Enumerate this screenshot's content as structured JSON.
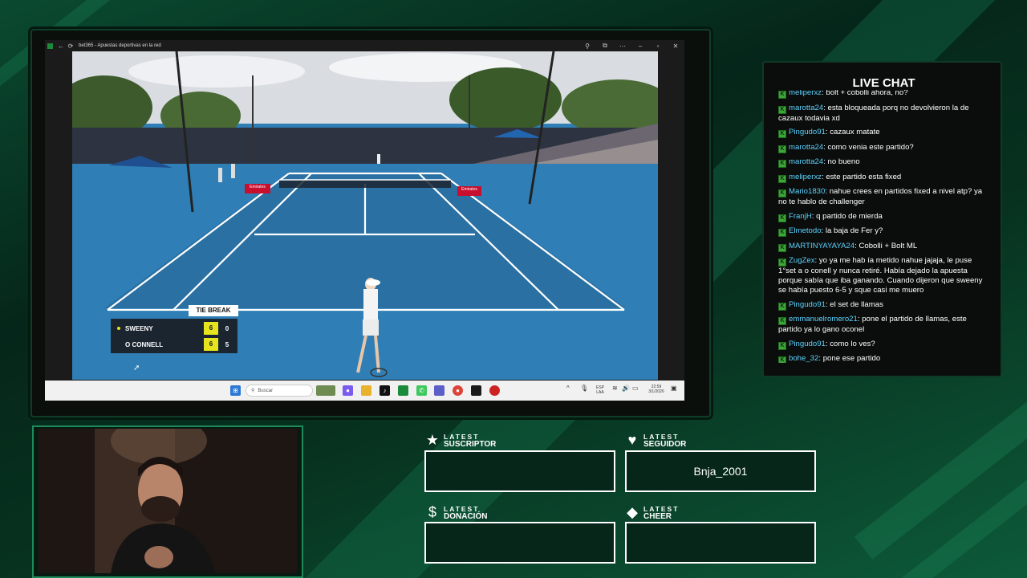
{
  "browser": {
    "title": "bet365 - Apuestas deportivas en la red"
  },
  "scoreboard": {
    "banner": "TIE BREAK",
    "players": [
      {
        "name": "SWEENY",
        "set": "6",
        "points": "0",
        "serving": true
      },
      {
        "name": "O CONNELL",
        "set": "6",
        "points": "5",
        "serving": false
      }
    ]
  },
  "court_signs": {
    "left": "Emirates",
    "right": "Emirates"
  },
  "taskbar": {
    "search_placeholder": "Buscar",
    "language": "ESP",
    "language_sub": "LAA",
    "time": "22:59",
    "date": "3/1/2026"
  },
  "chat": {
    "title": "LIVE CHAT",
    "messages": [
      {
        "user": "meliperxz",
        "text": "bolt + cobolli ahora, no?"
      },
      {
        "user": "marotta24",
        "text": "esta bloqueada porq no devolvieron la de cazaux todavia xd"
      },
      {
        "user": "Pingudo91",
        "text": "cazaux matate"
      },
      {
        "user": "marotta24",
        "text": "como venia este partido?"
      },
      {
        "user": "marotta24",
        "text": "no bueno"
      },
      {
        "user": "meliperxz",
        "text": "este partido esta fixed"
      },
      {
        "user": "Mario1830",
        "text": "nahue crees en partidos fixed a nivel atp? ya no te hablo de challenger"
      },
      {
        "user": "FranjH",
        "text": "q partido de mierda"
      },
      {
        "user": "Elmetodo",
        "text": "la baja de Fer y?"
      },
      {
        "user": "MARTINYAYAYA24",
        "text": "Cobolli + Bolt ML"
      },
      {
        "user": "ZugZex",
        "text": "yo ya me hab ía metido nahue jajaja, le puse 1°set a o conell y nunca retiré. Había dejado la apuesta porque sabía que iba ganando. Cuando dijeron que sweeny se había puesto 6-5 y sque casi me muero"
      },
      {
        "user": "Pingudo91",
        "text": "el set de llamas"
      },
      {
        "user": "emmanuelromero21",
        "text": "pone el partido de llamas, este partido ya lo gano oconel"
      },
      {
        "user": "Pingudo91",
        "text": "como lo ves?"
      },
      {
        "user": "bohe_32",
        "text": "pone ese partido"
      }
    ]
  },
  "widgets": {
    "subscriber": {
      "label1": "LATEST",
      "label2": "SUSCRIPTOR",
      "value": "",
      "icon": "star-icon"
    },
    "follower": {
      "label1": "LATEST",
      "label2": "SEGUIDOR",
      "value": "Bnja_2001",
      "icon": "heart-icon"
    },
    "donation": {
      "label1": "LATEST",
      "label2": "DONACIÓN",
      "value": "",
      "icon": "dollar-icon"
    },
    "cheer": {
      "label1": "LATEST",
      "label2": "CHEER",
      "value": "",
      "icon": "diamond-icon"
    }
  },
  "colors": {
    "accent_green": "#1e8a58",
    "score_yellow": "#e6e41e",
    "chat_username": "#5cd3ff",
    "court_blue": "#2f7fb6"
  }
}
